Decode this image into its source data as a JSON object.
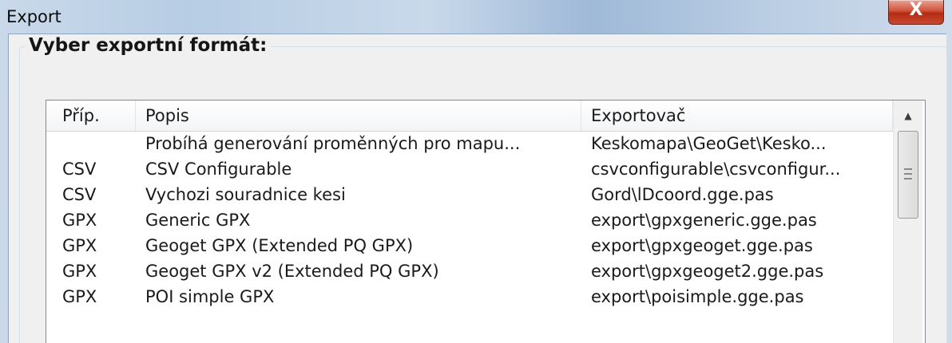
{
  "window": {
    "title": "Export",
    "close_glyph": "X"
  },
  "group": {
    "title": "Vyber exportní formát:"
  },
  "list": {
    "columns": [
      "Příp.",
      "Popis",
      "Exportovač"
    ],
    "rows": [
      [
        "",
        "Probíhá generování proměnných pro mapu...",
        "Keskomapa\\GeoGet\\Kesko..."
      ],
      [
        "CSV",
        "CSV Configurable",
        "csvconfigurable\\csvconfigur..."
      ],
      [
        "CSV",
        "Vychozi souradnice kesi",
        "Gord\\lDcoord.gge.pas"
      ],
      [
        "GPX",
        "Generic GPX",
        "export\\gpxgeneric.gge.pas"
      ],
      [
        "GPX",
        "Geoget GPX (Extended PQ GPX)",
        "export\\gpxgeoget.gge.pas"
      ],
      [
        "GPX",
        "Geoget GPX v2 (Extended PQ GPX)",
        "export\\gpxgeoget2.gge.pas"
      ],
      [
        "GPX",
        "POI simple GPX",
        "export\\poisimple.gge.pas"
      ]
    ]
  },
  "scrollbar": {
    "up_glyph": "▲"
  }
}
